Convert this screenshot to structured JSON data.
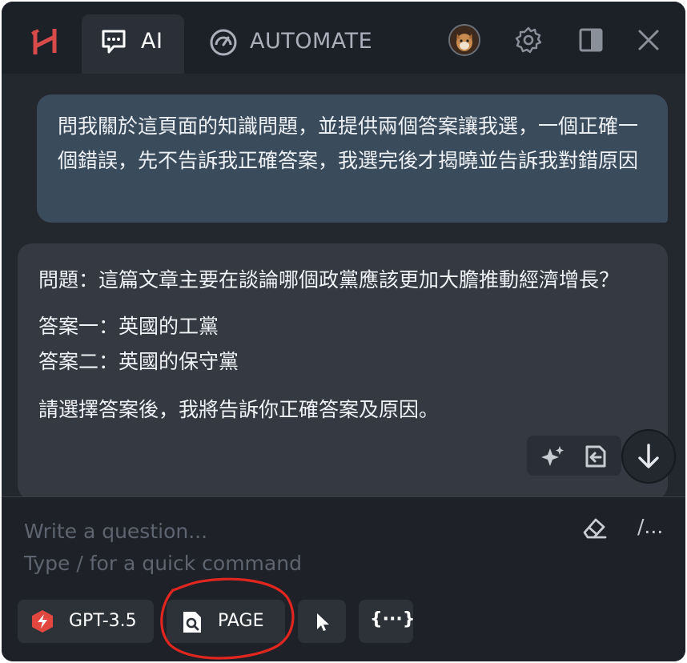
{
  "header": {
    "logo_icon": "hive-logo-icon",
    "tabs": [
      {
        "label": "AI",
        "icon": "chat-icon",
        "active": true
      },
      {
        "label": "AUTOMATE",
        "icon": "gauge-icon",
        "active": false
      }
    ],
    "actions": [
      "avatar",
      "gear-icon",
      "sidebar-toggle-icon",
      "close-icon"
    ]
  },
  "chat": {
    "user_message": "問我關於這頁面的知識問題，並提供兩個答案讓我選，一個正確一個錯誤，先不告訴我正確答案，我選完後才揭曉並告訴我對錯原因",
    "ai_message": {
      "question": "問題：這篇文章主要在談論哪個政黨應該更加大膽推動經濟增長？",
      "answer1": "答案一：英國的工黨",
      "answer2": "答案二：英國的保守黨",
      "footer": "請選擇答案後，我將告訴你正確答案及原因。"
    }
  },
  "input": {
    "placeholder_line1": "Write a question...",
    "placeholder_line2": "Type / for a quick command",
    "slash_label": "/..."
  },
  "toolbar": {
    "model_label": "GPT-3.5",
    "page_label": "PAGE",
    "vars_label": "{···}"
  },
  "colors": {
    "panel_bg": "#23272e",
    "user_bubble": "#3a4b5c",
    "ai_bubble": "#343942",
    "accent_red": "#e2473f",
    "annotation_red": "#e0261f"
  }
}
